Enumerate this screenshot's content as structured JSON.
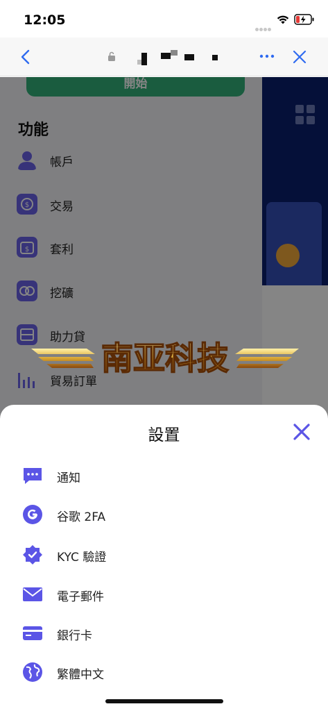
{
  "status_bar": {
    "time": "12:05"
  },
  "browser": {
    "back_icon": "chevron-left-icon",
    "lock_icon": "lock-icon",
    "more_icon": "ellipsis-icon",
    "close_icon": "close-icon",
    "accent": "#2f6bf0"
  },
  "background_page": {
    "start_button_label": "開始",
    "section_title": "功能",
    "menu": [
      {
        "label": "帳戶",
        "icon": "user-icon"
      },
      {
        "label": "交易",
        "icon": "exchange-icon"
      },
      {
        "label": "套利",
        "icon": "wallet-icon"
      },
      {
        "label": "挖礦",
        "icon": "mining-icon"
      },
      {
        "label": "助力貸",
        "icon": "loan-icon"
      },
      {
        "label": "貿易訂單",
        "icon": "bar-chart-icon"
      }
    ]
  },
  "watermark": {
    "text": "南亚科技"
  },
  "settings_sheet": {
    "title": "設置",
    "accent": "#5b55e6",
    "items": [
      {
        "label": "通知",
        "icon": "chat-bubble-icon"
      },
      {
        "label": "谷歌 2FA",
        "icon": "google-icon"
      },
      {
        "label": "KYC 驗證",
        "icon": "verified-badge-icon"
      },
      {
        "label": "電子郵件",
        "icon": "envelope-icon"
      },
      {
        "label": "銀行卡",
        "icon": "credit-card-icon"
      },
      {
        "label": "繁體中文",
        "icon": "globe-icon"
      }
    ]
  }
}
